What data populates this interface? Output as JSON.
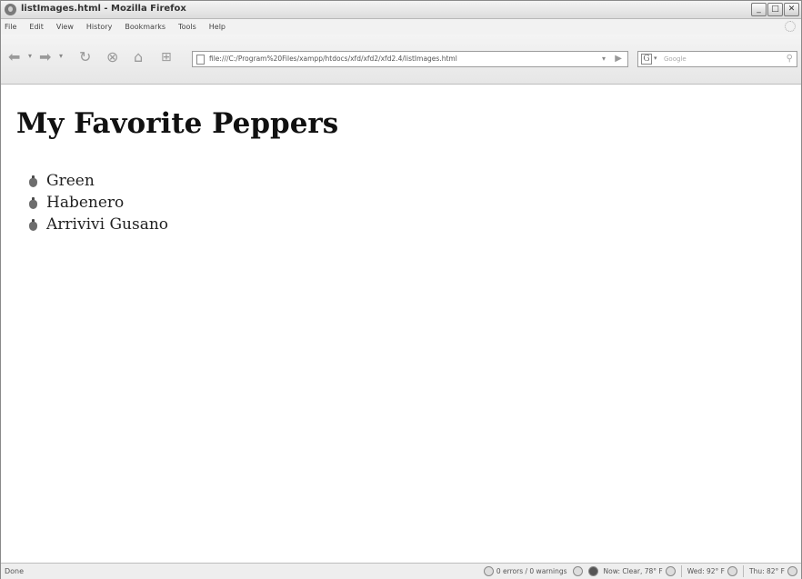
{
  "window": {
    "title": "listImages.html - Mozilla Firefox"
  },
  "menu": {
    "items": [
      "File",
      "Edit",
      "View",
      "History",
      "Bookmarks",
      "Tools",
      "Help"
    ]
  },
  "navigation": {
    "url": "file:///C:/Program%20Files/xampp/htdocs/xfd/xfd2/xfd2.4/listImages.html",
    "search_placeholder": "Google",
    "search_engine_glyph": "G"
  },
  "page": {
    "heading": "My Favorite Peppers",
    "items": [
      {
        "label": "Green"
      },
      {
        "label": "Habenero"
      },
      {
        "label": "Arrivivi Gusano"
      }
    ]
  },
  "status": {
    "text": "Done",
    "errors": "0 errors / 0 warnings",
    "weather_now": "Now: Clear, 78° F",
    "weather_wed": "Wed: 92° F",
    "weather_thu": "Thu: 82° F"
  }
}
